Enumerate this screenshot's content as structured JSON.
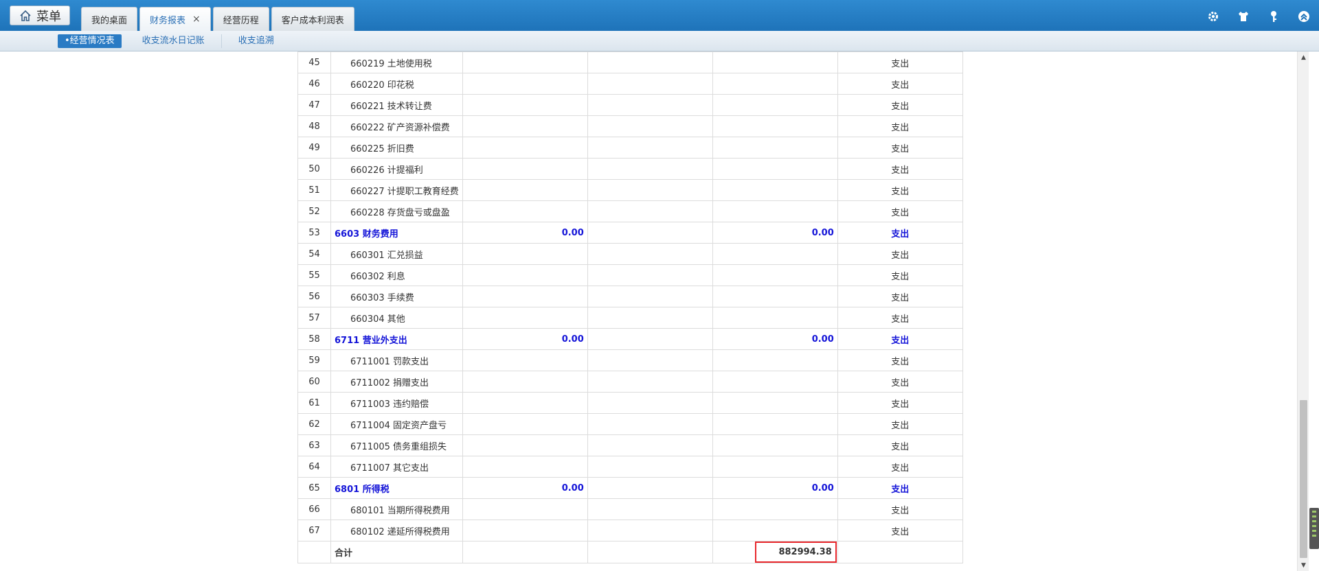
{
  "header": {
    "menu_label": "菜单",
    "tabs": [
      {
        "label": "我的桌面",
        "active": false,
        "closable": false
      },
      {
        "label": "财务报表",
        "active": true,
        "closable": true
      },
      {
        "label": "经营历程",
        "active": false,
        "closable": false
      },
      {
        "label": "客户成本利润表",
        "active": false,
        "closable": false
      }
    ],
    "close_glyph": "×",
    "icons": [
      "gear-icon",
      "shirt-icon",
      "key-icon",
      "collapse-up-icon"
    ]
  },
  "subnav": {
    "items": [
      {
        "label": "•经营情况表",
        "active": true
      },
      {
        "label": "收支流水日记账",
        "active": false
      },
      {
        "label": "收支追溯",
        "active": false
      }
    ]
  },
  "table": {
    "rows": [
      {
        "no": "45",
        "name": "660219 土地使用税",
        "v1": "",
        "v3": "",
        "type": "支出",
        "kind": "sub"
      },
      {
        "no": "46",
        "name": "660220 印花税",
        "v1": "",
        "v3": "",
        "type": "支出",
        "kind": "sub"
      },
      {
        "no": "47",
        "name": "660221 技术转让费",
        "v1": "",
        "v3": "",
        "type": "支出",
        "kind": "sub"
      },
      {
        "no": "48",
        "name": "660222 矿产资源补偿费",
        "v1": "",
        "v3": "",
        "type": "支出",
        "kind": "sub"
      },
      {
        "no": "49",
        "name": "660225 折旧费",
        "v1": "",
        "v3": "",
        "type": "支出",
        "kind": "sub"
      },
      {
        "no": "50",
        "name": "660226 计提福利",
        "v1": "",
        "v3": "",
        "type": "支出",
        "kind": "sub"
      },
      {
        "no": "51",
        "name": "660227 计提职工教育经费",
        "v1": "",
        "v3": "",
        "type": "支出",
        "kind": "sub"
      },
      {
        "no": "52",
        "name": "660228 存货盘亏或盘盈",
        "v1": "",
        "v3": "",
        "type": "支出",
        "kind": "sub"
      },
      {
        "no": "53",
        "name": "6603 财务费用",
        "v1": "0.00",
        "v3": "0.00",
        "type": "支出",
        "kind": "group"
      },
      {
        "no": "54",
        "name": "660301 汇兑损益",
        "v1": "",
        "v3": "",
        "type": "支出",
        "kind": "sub"
      },
      {
        "no": "55",
        "name": "660302 利息",
        "v1": "",
        "v3": "",
        "type": "支出",
        "kind": "sub"
      },
      {
        "no": "56",
        "name": "660303 手续费",
        "v1": "",
        "v3": "",
        "type": "支出",
        "kind": "sub"
      },
      {
        "no": "57",
        "name": "660304 其他",
        "v1": "",
        "v3": "",
        "type": "支出",
        "kind": "sub"
      },
      {
        "no": "58",
        "name": "6711 营业外支出",
        "v1": "0.00",
        "v3": "0.00",
        "type": "支出",
        "kind": "group"
      },
      {
        "no": "59",
        "name": "6711001 罚款支出",
        "v1": "",
        "v3": "",
        "type": "支出",
        "kind": "sub"
      },
      {
        "no": "60",
        "name": "6711002 捐赠支出",
        "v1": "",
        "v3": "",
        "type": "支出",
        "kind": "sub"
      },
      {
        "no": "61",
        "name": "6711003 违约赔偿",
        "v1": "",
        "v3": "",
        "type": "支出",
        "kind": "sub"
      },
      {
        "no": "62",
        "name": "6711004 固定资产盘亏",
        "v1": "",
        "v3": "",
        "type": "支出",
        "kind": "sub"
      },
      {
        "no": "63",
        "name": "6711005 债务重组损失",
        "v1": "",
        "v3": "",
        "type": "支出",
        "kind": "sub"
      },
      {
        "no": "64",
        "name": "6711007 其它支出",
        "v1": "",
        "v3": "",
        "type": "支出",
        "kind": "sub"
      },
      {
        "no": "65",
        "name": "6801 所得税",
        "v1": "0.00",
        "v3": "0.00",
        "type": "支出",
        "kind": "group"
      },
      {
        "no": "66",
        "name": "680101 当期所得税费用",
        "v1": "",
        "v3": "",
        "type": "支出",
        "kind": "sub"
      },
      {
        "no": "67",
        "name": "680102 递延所得税费用",
        "v1": "",
        "v3": "",
        "type": "支出",
        "kind": "sub"
      }
    ],
    "total": {
      "label": "合计",
      "value": "882994.38"
    }
  },
  "scrollbar": {
    "up_glyph": "▲",
    "down_glyph": "▼"
  }
}
